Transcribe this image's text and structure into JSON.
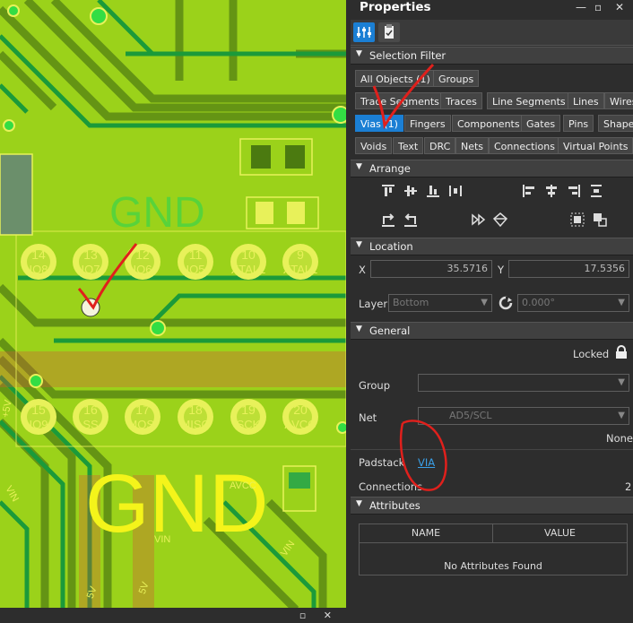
{
  "pcb": {
    "labels_top": [
      {
        "num": "14",
        "name": "IO8"
      },
      {
        "num": "13",
        "name": "IO7"
      },
      {
        "num": "12",
        "name": "IO6"
      },
      {
        "num": "11",
        "name": "IO5"
      },
      {
        "num": "10",
        "name": "XTAL2"
      },
      {
        "num": "9",
        "name": "XTAL1"
      }
    ],
    "labels_bottom": [
      {
        "num": "15",
        "name": "IO9"
      },
      {
        "num": "16",
        "name": "SS"
      },
      {
        "num": "17",
        "name": "MOSI"
      },
      {
        "num": "18",
        "name": "MISO"
      },
      {
        "num": "19",
        "name": "SCK"
      },
      {
        "num": "20",
        "name": "AVCC"
      }
    ],
    "gnd_small": "GND",
    "gnd_large": "GND",
    "net_labels": {
      "vin_a": "VIN",
      "vin_b": "VIN",
      "vin_c": "VIN",
      "avcc": "AVCC",
      "fivev_a": "+5V",
      "fivev_b": "5V",
      "fivev_c": "5V"
    }
  },
  "panel": {
    "title": "Properties",
    "pin_label": "—",
    "float_label": "▫",
    "close_label": "✕",
    "selection_filter": {
      "header": "Selection Filter",
      "chips": [
        {
          "label": "All Objects (1)",
          "active": false
        },
        {
          "label": "Groups",
          "active": false
        },
        {
          "label": "Trace Segments",
          "active": false
        },
        {
          "label": "Traces",
          "active": false
        },
        {
          "label": "Line Segments",
          "active": false
        },
        {
          "label": "Lines",
          "active": false
        },
        {
          "label": "Wires",
          "active": false
        },
        {
          "label": "Vias (1)",
          "active": true
        },
        {
          "label": "Fingers",
          "active": false
        },
        {
          "label": "Components",
          "active": false
        },
        {
          "label": "Gates",
          "active": false
        },
        {
          "label": "Pins",
          "active": false
        },
        {
          "label": "Shapes",
          "active": false
        },
        {
          "label": "Voids",
          "active": false
        },
        {
          "label": "Text",
          "active": false
        },
        {
          "label": "DRC",
          "active": false
        },
        {
          "label": "Nets",
          "active": false
        },
        {
          "label": "Connections",
          "active": false
        },
        {
          "label": "Virtual Points",
          "active": false
        }
      ]
    },
    "arrange": {
      "header": "Arrange"
    },
    "location": {
      "header": "Location",
      "x_label": "X",
      "x_value": "35.5716",
      "y_label": "Y",
      "y_value": "17.5356",
      "layer_label": "Layer",
      "layer_value": "Bottom",
      "rotation_value": "0.000°"
    },
    "general": {
      "header": "General",
      "locked_label": "Locked",
      "group_label": "Group",
      "group_value": "",
      "net_label": "Net",
      "net_value": "AD5/SCL",
      "net_class": "None",
      "padstack_label": "Padstack",
      "padstack_value": "VIA",
      "connections_label": "Connections",
      "connections_value": "2"
    },
    "attributes": {
      "header": "Attributes",
      "col_name": "NAME",
      "col_value": "VALUE",
      "empty": "No Attributes Found"
    }
  },
  "colors": {
    "board": "#9bd21a",
    "trace_dark": "#4b7a10",
    "trace_green": "#1b9a3a",
    "silkscreen": "#e8f15a",
    "accent_blue": "#1b7fd4",
    "annotation_red": "#e0201c"
  }
}
